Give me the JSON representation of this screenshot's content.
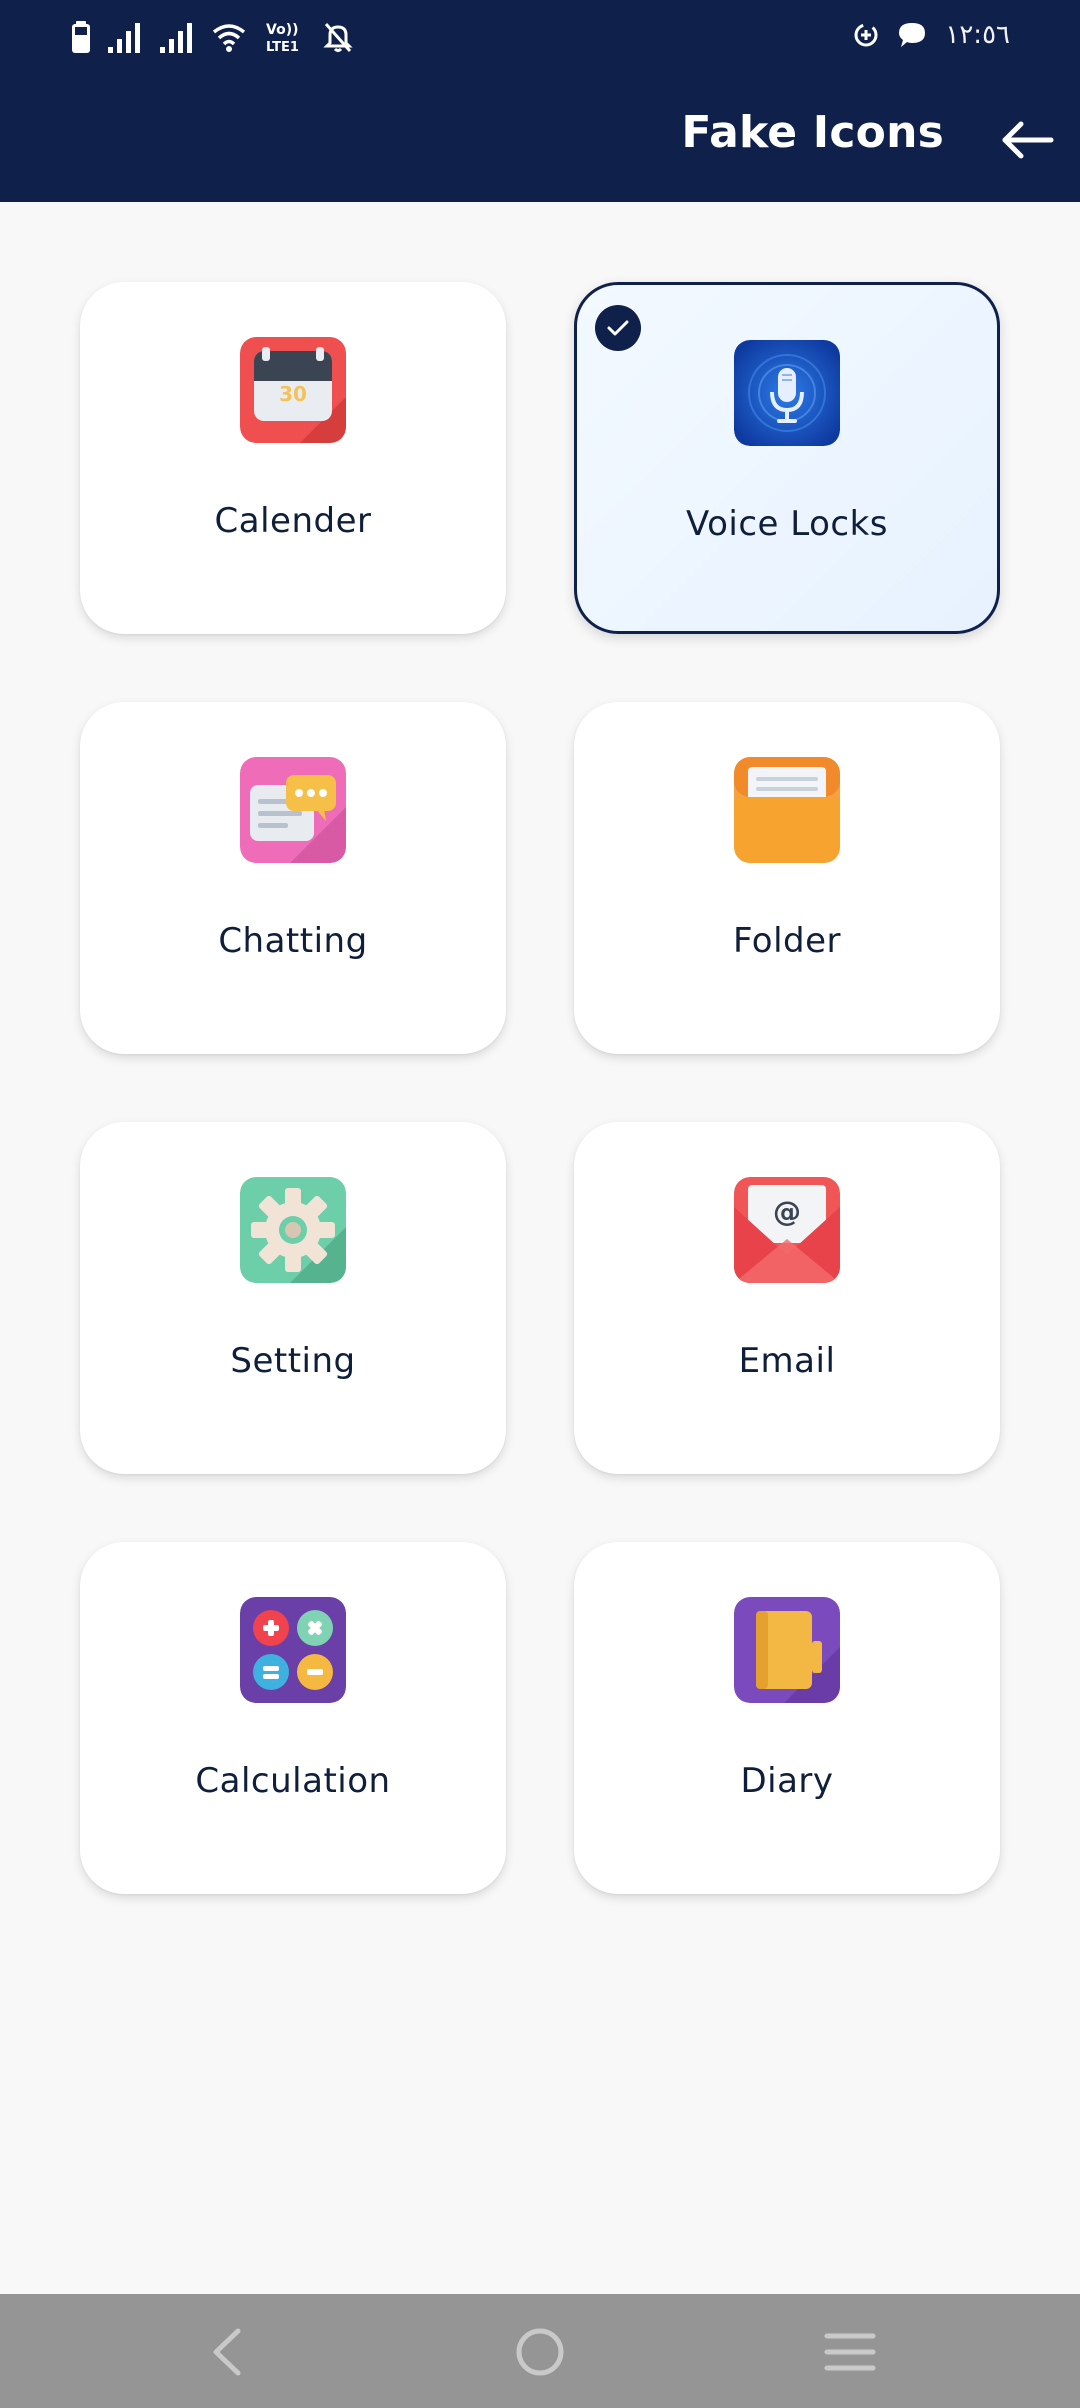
{
  "status_bar": {
    "time": "١٢:٥٦",
    "icons": [
      "battery-icon",
      "signal-icon",
      "signal-icon",
      "wifi-icon",
      "volte-icon",
      "bell-off-icon",
      "data-saver-icon",
      "chat-bubble-icon"
    ]
  },
  "header": {
    "title": "Fake Icons",
    "back_icon": "arrow-left-icon",
    "background": "#0f204b"
  },
  "cards": [
    {
      "label": "Calender",
      "icon": "calendar-icon",
      "icon_text": "30",
      "selected": false
    },
    {
      "label": "Voice Locks",
      "icon": "microphone-icon",
      "selected": true
    },
    {
      "label": "Chatting",
      "icon": "chat-icon",
      "selected": false
    },
    {
      "label": "Folder",
      "icon": "folder-icon",
      "selected": false
    },
    {
      "label": "Setting",
      "icon": "gear-icon",
      "selected": false
    },
    {
      "label": "Email",
      "icon": "email-icon",
      "icon_text": "@",
      "selected": false
    },
    {
      "label": "Calculation",
      "icon": "calculator-icon",
      "selected": false
    },
    {
      "label": "Diary",
      "icon": "diary-icon",
      "selected": false
    }
  ],
  "navbar": {
    "items": [
      "nav-back-icon",
      "nav-home-icon",
      "nav-menu-icon"
    ]
  },
  "colors": {
    "primary": "#0f204b",
    "background": "#f8f8f8",
    "card": "#ffffff",
    "selected_card": "#e7f2ff",
    "navbar": "#959595"
  }
}
